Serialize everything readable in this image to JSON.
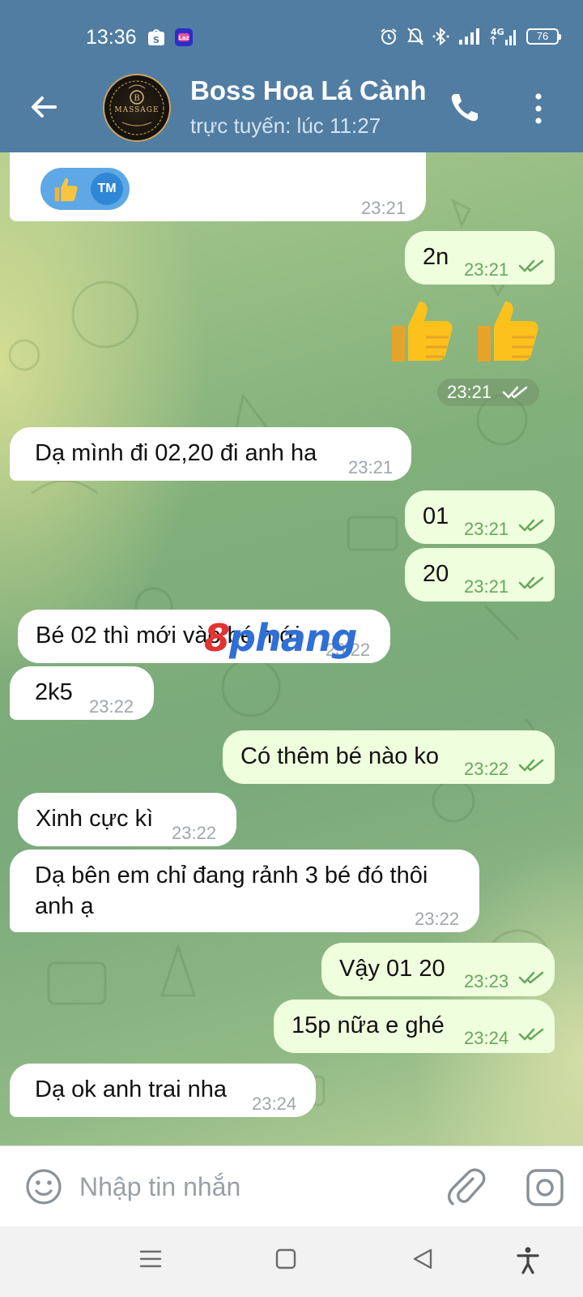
{
  "status_bar": {
    "time": "13:36",
    "battery": "76",
    "network": "4G"
  },
  "header": {
    "title": "Boss Hoa Lá Cành",
    "subtitle": "trực tuyến: lúc 11:27",
    "avatar_text": "MASSAGE"
  },
  "messages": [
    {
      "dir": "in",
      "reaction": "TM",
      "time": "23:21"
    },
    {
      "dir": "out",
      "text": "2n",
      "time": "23:21"
    },
    {
      "dir": "out",
      "emoji": "thumbs-up x2",
      "time": "23:21"
    },
    {
      "dir": "in",
      "text": "Dạ mình đi 02,20 đi anh ha",
      "time": "23:21"
    },
    {
      "dir": "out",
      "text": "01",
      "time": "23:21"
    },
    {
      "dir": "out",
      "text": "20",
      "time": "23:21"
    },
    {
      "dir": "in",
      "text": "Bé 02 thì mới vào bé mới",
      "time": "23:22"
    },
    {
      "dir": "in",
      "text": "2k5",
      "time": "23:22"
    },
    {
      "dir": "out",
      "text": "Có thêm bé nào ko",
      "time": "23:22"
    },
    {
      "dir": "in",
      "text": "Xinh cực kì",
      "time": "23:22"
    },
    {
      "dir": "in",
      "text_line1": "Dạ bên em chỉ đang rảnh 3 bé đó thôi",
      "text_line2": "anh ạ",
      "time": "23:22"
    },
    {
      "dir": "out",
      "text": "Vậy 01 20",
      "time": "23:23"
    },
    {
      "dir": "out",
      "text": "15p nữa e ghé",
      "time": "23:24"
    },
    {
      "dir": "in",
      "text": "Dạ ok anh trai nha",
      "time": "23:24"
    }
  ],
  "watermark": {
    "part1": "8",
    "part2": "phang"
  },
  "composer": {
    "placeholder": "Nhập tin nhắn"
  },
  "colors": {
    "header": "#517da2",
    "incoming_bubble": "#ffffff",
    "outgoing_bubble": "#effedd",
    "outgoing_time": "#66a75e",
    "reaction": "#5ea8e5"
  },
  "icons": [
    "back-arrow-icon",
    "phone-icon",
    "more-vert-icon",
    "smile-icon",
    "paperclip-icon",
    "instagram-icon",
    "double-check-icon",
    "thumbs-up-icon",
    "menu-nav-icon",
    "home-nav-icon",
    "back-nav-icon",
    "accessibility-icon"
  ]
}
